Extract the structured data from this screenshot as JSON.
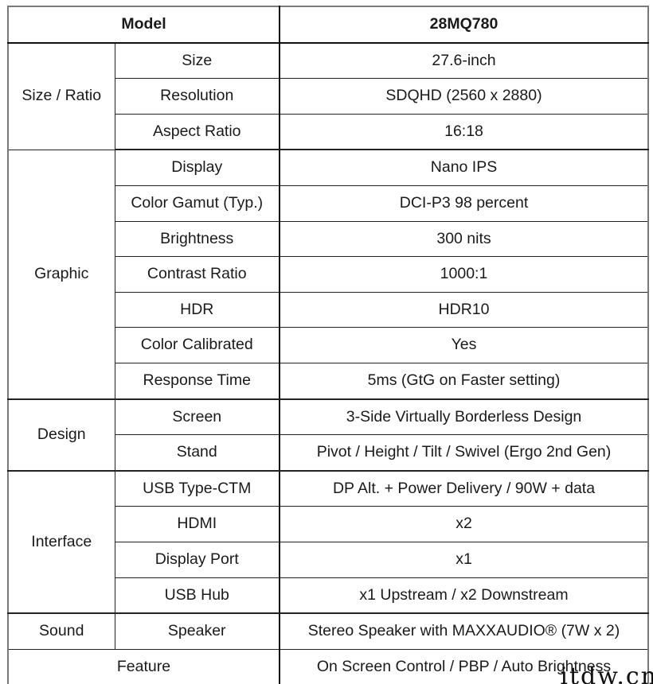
{
  "table": {
    "header": {
      "label": "Model",
      "value": "28MQ780"
    },
    "groups": [
      {
        "category": "Size / Ratio",
        "rows": [
          {
            "spec": "Size",
            "value": "27.6-inch"
          },
          {
            "spec": "Resolution",
            "value": "SDQHD (2560 x 2880)"
          },
          {
            "spec": "Aspect Ratio",
            "value": "16:18"
          }
        ]
      },
      {
        "category": "Graphic",
        "rows": [
          {
            "spec": "Display",
            "value": "Nano IPS"
          },
          {
            "spec": "Color Gamut (Typ.)",
            "value": "DCI-P3 98 percent"
          },
          {
            "spec": "Brightness",
            "value": "300 nits"
          },
          {
            "spec": "Contrast Ratio",
            "value": "1000:1"
          },
          {
            "spec": "HDR",
            "value": "HDR10"
          },
          {
            "spec": "Color Calibrated",
            "value": "Yes"
          },
          {
            "spec": "Response Time",
            "value": "5ms (GtG on Faster setting)"
          }
        ]
      },
      {
        "category": "Design",
        "rows": [
          {
            "spec": "Screen",
            "value": "3-Side Virtually Borderless Design"
          },
          {
            "spec": "Stand",
            "value": "Pivot / Height / Tilt / Swivel (Ergo 2nd Gen)"
          }
        ]
      },
      {
        "category": "Interface",
        "rows": [
          {
            "spec": "USB Type-CTM",
            "value": "DP Alt. + Power Delivery / 90W + data"
          },
          {
            "spec": "HDMI",
            "value": "x2"
          },
          {
            "spec": "Display Port",
            "value": "x1"
          },
          {
            "spec": "USB Hub",
            "value": "x1 Upstream / x2 Downstream"
          }
        ]
      },
      {
        "category": "Sound",
        "rows": [
          {
            "spec": "Speaker",
            "value": "Stereo Speaker with MAXXAUDIO® (7W x 2)"
          }
        ]
      }
    ],
    "footer": {
      "label": "Feature",
      "value": "On Screen Control / PBP / Auto Brightness"
    }
  },
  "watermark": "itdw.cn"
}
